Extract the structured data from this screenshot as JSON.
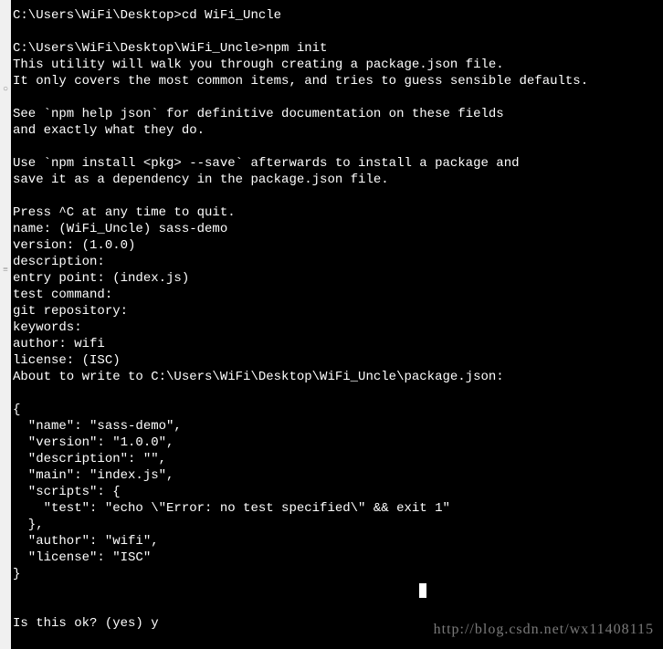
{
  "gutter": {
    "icon_top": "○",
    "icon_mid": "≡"
  },
  "terminal": {
    "lines": [
      "C:\\Users\\WiFi\\Desktop>cd WiFi_Uncle",
      "",
      "C:\\Users\\WiFi\\Desktop\\WiFi_Uncle>npm init",
      "This utility will walk you through creating a package.json file.",
      "It only covers the most common items, and tries to guess sensible defaults.",
      "",
      "See `npm help json` for definitive documentation on these fields",
      "and exactly what they do.",
      "",
      "Use `npm install <pkg> --save` afterwards to install a package and",
      "save it as a dependency in the package.json file.",
      "",
      "Press ^C at any time to quit.",
      "name: (WiFi_Uncle) sass-demo",
      "version: (1.0.0)",
      "description:",
      "entry point: (index.js)",
      "test command:",
      "git repository:",
      "keywords:",
      "author: wifi",
      "license: (ISC)",
      "About to write to C:\\Users\\WiFi\\Desktop\\WiFi_Uncle\\package.json:",
      "",
      "{",
      "  \"name\": \"sass-demo\",",
      "  \"version\": \"1.0.0\",",
      "  \"description\": \"\",",
      "  \"main\": \"index.js\",",
      "  \"scripts\": {",
      "    \"test\": \"echo \\\"Error: no test specified\\\" && exit 1\"",
      "  },",
      "  \"author\": \"wifi\",",
      "  \"license\": \"ISC\"",
      "}",
      "",
      "",
      "Is this ok? (yes) y"
    ],
    "cursor_line_index": 35,
    "cursor_prefix": "                                                     "
  },
  "watermark": "http://blog.csdn.net/wx11408115"
}
